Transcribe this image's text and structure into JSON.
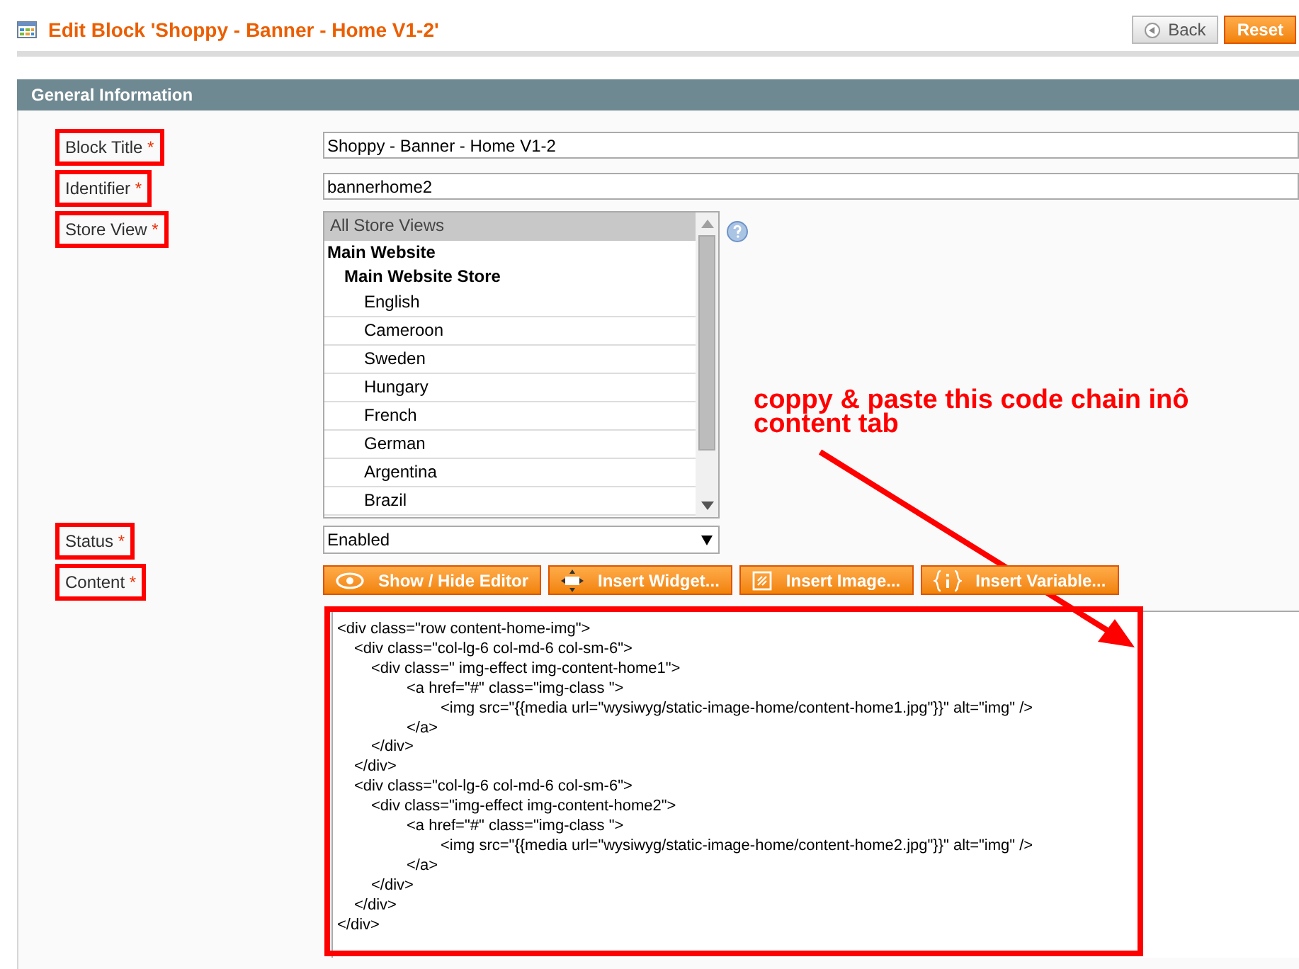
{
  "page_title": "Edit Block 'Shoppy - Banner - Home V1-2'",
  "header_buttons": [
    {
      "label": "Back",
      "kind": "back"
    },
    {
      "label": "Reset",
      "kind": "primary"
    }
  ],
  "section_title": "General Information",
  "fields": [
    {
      "label": "Block Title",
      "required": "*",
      "kind": "text",
      "value": "Shoppy - Banner - Home V1-2"
    },
    {
      "label": "Identifier",
      "required": "*",
      "kind": "text",
      "value": "bannerhome2"
    },
    {
      "label": "Store View",
      "required": "*",
      "kind": "multiselect",
      "options": [
        {
          "label": "All Store Views",
          "selected": true
        },
        {
          "label": "Main Website",
          "children": [
            {
              "label": "Main Website Store",
              "children": [
                {
                  "label": "English",
                  "selected": false
                },
                {
                  "label": "Cameroon",
                  "selected": false
                },
                {
                  "label": "Sweden",
                  "selected": false
                },
                {
                  "label": "Hungary",
                  "selected": false
                },
                {
                  "label": "French",
                  "selected": false
                },
                {
                  "label": "German",
                  "selected": false
                },
                {
                  "label": "Argentina",
                  "selected": false
                },
                {
                  "label": "Brazil",
                  "selected": false
                }
              ]
            }
          ]
        }
      ]
    },
    {
      "label": "Status",
      "required": "*",
      "kind": "select",
      "value": "Enabled"
    },
    {
      "label": "Content",
      "required": "*",
      "kind": "editor",
      "buttons": [
        {
          "label": "Show / Hide Editor",
          "kind": "eye"
        },
        {
          "label": "Insert Widget...",
          "kind": "widget"
        },
        {
          "label": "Insert Image...",
          "kind": "image"
        },
        {
          "label": "Insert Variable...",
          "kind": "variable"
        }
      ],
      "code": [
        {
          "open": "<div class=\"row content-home-img\">",
          "close": "</div>",
          "children": [
            {
              "open": "<div class=\"col-lg-6 col-md-6 col-sm-6\">",
              "close": "</div>",
              "children": [
                {
                  "open": "<div class=\" img-effect img-content-home1\">",
                  "close": "</div>",
                  "children": [
                    {
                      "open": "<a href=\"#\" class=\"img-class \">",
                      "close": "</a>",
                      "children": [
                        {
                          "open": "<img src=\"{{media url=\"wysiwyg/static-image-home/content-home1.jpg\"}}\" alt=\"img\" />"
                        }
                      ]
                    }
                  ]
                }
              ]
            },
            {
              "open": "<div class=\"col-lg-6 col-md-6 col-sm-6\">",
              "close": "</div>",
              "children": [
                {
                  "open": "<div class=\"img-effect img-content-home2\">",
                  "close": "</div>",
                  "children": [
                    {
                      "open": "<a href=\"#\" class=\"img-class \">",
                      "close": "</a>",
                      "children": [
                        {
                          "open": "<img src=\"{{media url=\"wysiwyg/static-image-home/content-home2.jpg\"}}\" alt=\"img\" />"
                        }
                      ]
                    }
                  ]
                }
              ]
            }
          ]
        }
      ]
    }
  ],
  "annotation": {
    "text": "coppy & paste this code chain inô content tab"
  }
}
